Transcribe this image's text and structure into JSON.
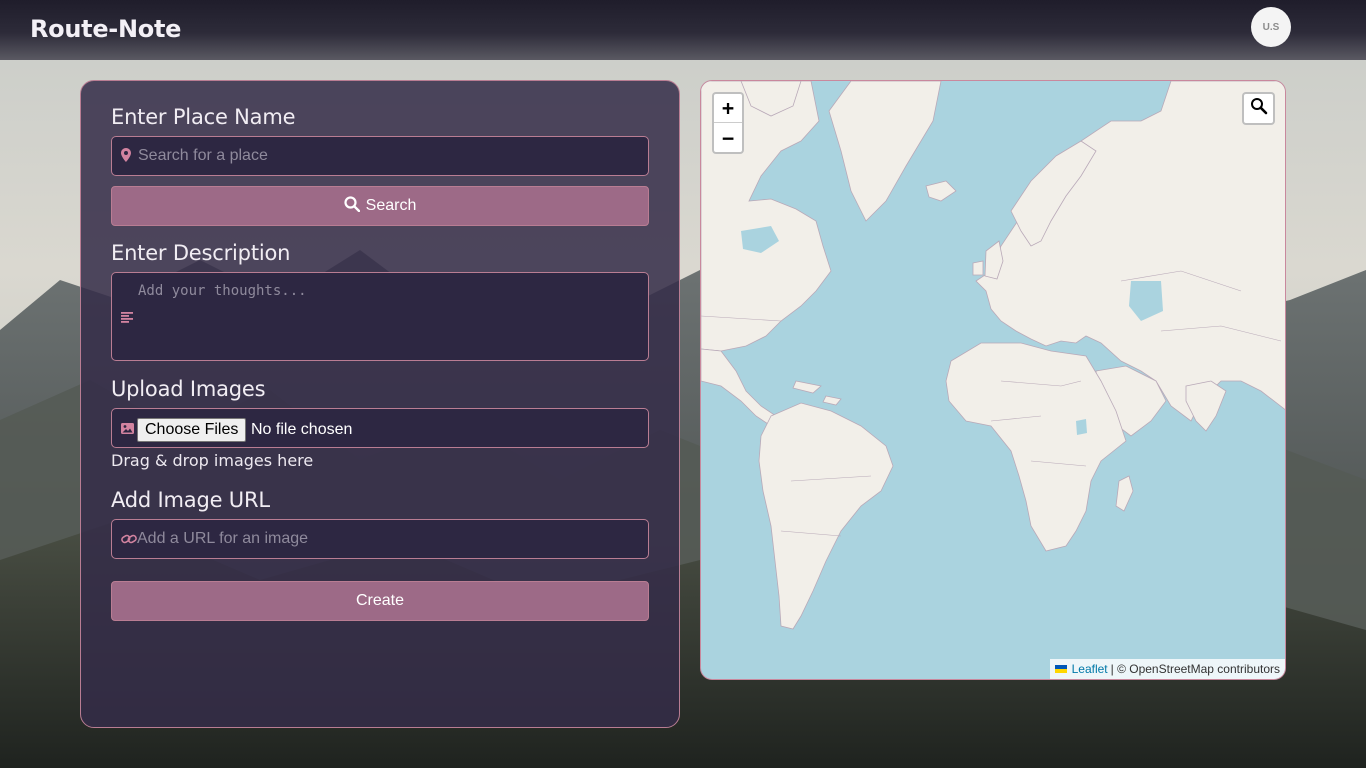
{
  "header": {
    "brand": "Route-Note",
    "avatar_initials": "U.S"
  },
  "form": {
    "place": {
      "heading": "Enter Place Name",
      "icon": "map-marker-icon",
      "placeholder": "Search for a place"
    },
    "search_button": {
      "icon": "search-icon",
      "label": "Search"
    },
    "description": {
      "heading": "Enter Description",
      "icon": "align-left-icon",
      "placeholder": "Add your thoughts..."
    },
    "images": {
      "heading": "Upload Images",
      "icon": "image-icon",
      "choose_label": "Choose Files",
      "status": "No file chosen",
      "drag_text": "Drag & drop images here"
    },
    "image_url": {
      "heading": "Add Image URL",
      "icon": "link-icon",
      "placeholder": "Add a URL for an image"
    },
    "create_button": {
      "label": "Create"
    }
  },
  "map": {
    "zoom_in": "+",
    "zoom_out": "−",
    "search_icon": "search-icon",
    "attribution": {
      "leaflet": "Leaflet",
      "rest": "| © OpenStreetMap contributors"
    }
  },
  "colors": {
    "accent": "#9d6a87",
    "border": "#b97d93",
    "panel": "#342c48",
    "field": "#2d2742",
    "ocean": "#aad3df",
    "land": "#f2efe9"
  }
}
